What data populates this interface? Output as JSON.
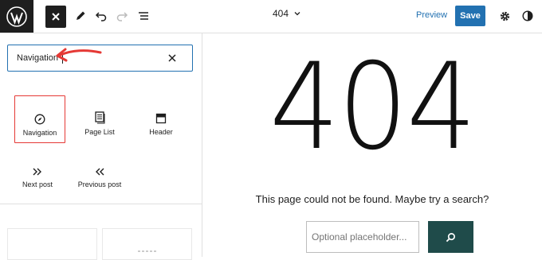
{
  "topbar": {
    "document_title": "404",
    "preview_label": "Preview",
    "save_label": "Save"
  },
  "inserter": {
    "search_value": "Navigation",
    "blocks": [
      {
        "label": "Navigation",
        "icon": "compass-icon",
        "selected": true
      },
      {
        "label": "Page List",
        "icon": "page-list-icon",
        "selected": false
      },
      {
        "label": "Header",
        "icon": "header-icon",
        "selected": false
      },
      {
        "label": "Next post",
        "icon": "chevron-double-right-icon",
        "selected": false
      },
      {
        "label": "Previous post",
        "icon": "chevron-double-left-icon",
        "selected": false
      }
    ]
  },
  "canvas": {
    "heading": "404",
    "message": "This page could not be found. Maybe try a search?",
    "search_placeholder": "Optional placeholder..."
  },
  "colors": {
    "accent": "#2271b1",
    "dark": "#1e1e1e",
    "annotation": "#e53935",
    "search_button": "#1f4b4a"
  }
}
